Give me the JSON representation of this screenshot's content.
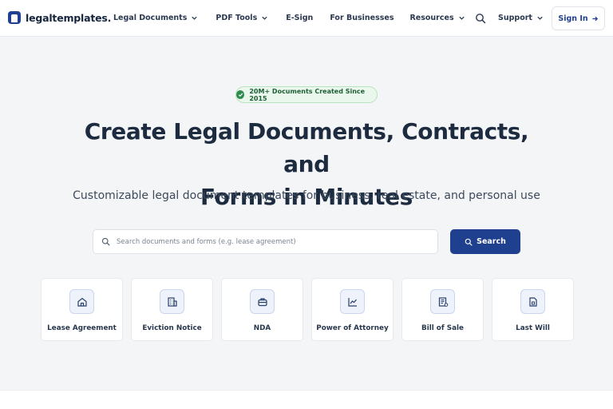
{
  "header": {
    "logo_text": "legaltemplates.",
    "nav": [
      {
        "label": "Legal Documents",
        "dropdown": true
      },
      {
        "label": "PDF Tools",
        "dropdown": true
      },
      {
        "label": "E-Sign",
        "dropdown": false
      },
      {
        "label": "For Businesses",
        "dropdown": false
      },
      {
        "label": "Resources",
        "dropdown": true
      }
    ],
    "support_label": "Support",
    "signin_label": "Sign In",
    "search_icon": "search-icon"
  },
  "hero": {
    "badge_text": "20M+ Documents Created Since 2015",
    "title_line1": "Create Legal Documents, Contracts,  and",
    "title_line2": "Forms in Minutes",
    "subtitle": "Customizable legal document templates for business, real estate, and personal use",
    "search_placeholder": "Search documents and forms (e.g. lease agreement)",
    "search_button": "Search"
  },
  "cards": [
    {
      "label": "Lease Agreement",
      "icon": "house-icon"
    },
    {
      "label": "Eviction Notice",
      "icon": "building-icon"
    },
    {
      "label": "NDA",
      "icon": "briefcase-icon"
    },
    {
      "label": "Power of Attorney",
      "icon": "chart-line-icon"
    },
    {
      "label": "Bill of Sale",
      "icon": "receipt-icon"
    },
    {
      "label": "Last Will",
      "icon": "document-icon"
    }
  ],
  "colors": {
    "brand": "#1f3f8f",
    "badge_bg": "#e9f7ec",
    "badge_check": "#2e8b4e",
    "page_bg": "#f4f5f7"
  }
}
